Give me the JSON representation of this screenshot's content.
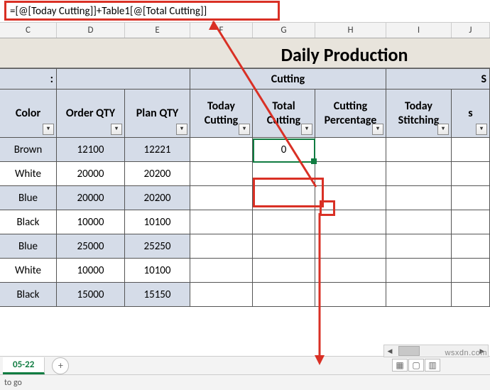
{
  "formula": "=[@[Today Cutting]]+Table1[@[Total Cutting]]",
  "col_headers": [
    "C",
    "D",
    "E",
    "F",
    "G",
    "H",
    "I",
    "J"
  ],
  "title": "Daily Production",
  "merged_headers": {
    "cutting": "Cutting",
    "stitching": "S"
  },
  "section_left": ":",
  "columns": {
    "color": "Color",
    "order_qty": "Order QTY",
    "plan_qty": "Plan QTY",
    "today_cutting": "Today Cutting",
    "total_cutting": "Total Cutting",
    "cutting_pct": "Cutting Percentage",
    "today_stitching": "Today Stitching",
    "s_col": "s"
  },
  "rows": [
    {
      "color": "Brown",
      "order": "12100",
      "plan": "12221",
      "tc": "",
      "total": "0"
    },
    {
      "color": "White",
      "order": "20000",
      "plan": "20200",
      "tc": "",
      "total": ""
    },
    {
      "color": "Blue",
      "order": "20000",
      "plan": "20200",
      "tc": "",
      "total": ""
    },
    {
      "color": "Black",
      "order": "10000",
      "plan": "10100",
      "tc": "",
      "total": ""
    },
    {
      "color": "Blue",
      "order": "25000",
      "plan": "25250",
      "tc": "",
      "total": ""
    },
    {
      "color": "White",
      "order": "10000",
      "plan": "10100",
      "tc": "",
      "total": ""
    },
    {
      "color": "Black",
      "order": "15000",
      "plan": "15150",
      "tc": "",
      "total": ""
    }
  ],
  "tab": "05-22",
  "status": "to go",
  "watermark": "wsxdn.com",
  "icons": {
    "filter": "▾",
    "add": "+",
    "scroll_left": "◀",
    "scroll_right": "▶"
  }
}
